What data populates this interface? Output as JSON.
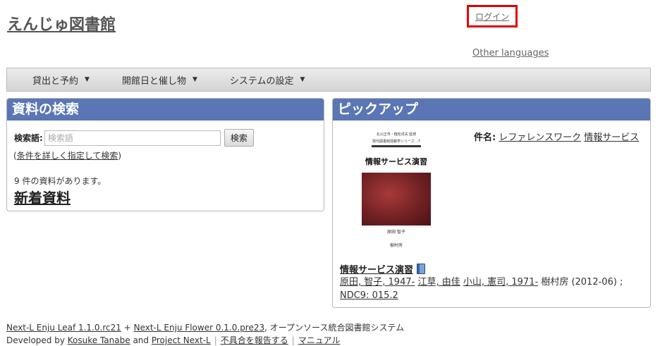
{
  "site": {
    "title": "えんじゅ図書館"
  },
  "header": {
    "login_label": "ログイン",
    "other_languages": "Other languages"
  },
  "menu": [
    {
      "label": "貸出と予約"
    },
    {
      "label": "開館日と催し物"
    },
    {
      "label": "システムの設定"
    }
  ],
  "search_panel": {
    "title": "資料の検索",
    "field_label": "検索語:",
    "placeholder": "検索語",
    "button_label": "検索",
    "advanced_open": "(",
    "advanced_link": "条件を詳しく指定して検索",
    "advanced_close": ")",
    "count_text": "9 件の資料があります。",
    "new_items_title": "新着資料"
  },
  "pickup_panel": {
    "title": "ピックアップ",
    "cover": {
      "series_line1": "北公正市・植松貞夫 監修",
      "series_line2": "現代図書館情報学シリーズ…7",
      "title": "情報サービス演習",
      "author": "原田 智子",
      "publisher": "樹村房"
    },
    "subject_label": "件名:",
    "subjects": [
      "レファレンスワーク",
      "情報サービス"
    ],
    "book_title": "情報サービス演習",
    "authors": [
      "原田, 智子, 1947-",
      "江草, 由佳",
      "小山, 憲司, 1971-"
    ],
    "publisher_year": "樹村房 (2012-06) ;",
    "ndc": "NDC9: 015.2"
  },
  "footer": {
    "leaf": "Next-L Enju Leaf 1.1.0.rc21",
    "plus": "+",
    "flower": "Next-L Enju Flower 0.1.0.pre23",
    "system_text": ", オープンソース統合図書館システム",
    "developed_by": "Developed by",
    "dev_name": "Kosuke Tanabe",
    "and": "and",
    "project": "Project Next-L",
    "report": "不具合を報告する",
    "manual": "マニュアル"
  }
}
